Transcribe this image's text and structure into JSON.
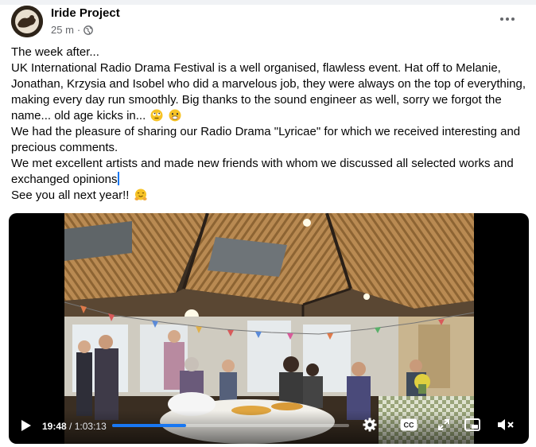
{
  "post": {
    "author": "Iride Project",
    "time": "25 m",
    "separator": "·",
    "lines": [
      "The week after...",
      "UK International Radio Drama Festival is a well organised, flawless event.  Hat off to Melanie,",
      "Jonathan, Krzysia and Isobel who did a marvelous job, they were always on the top of everything,",
      "making every day run smoothly. Big thanks to the sound engineer as well, sorry we forgot the",
      "name... old age kicks in...",
      "We had the pleasure of sharing our Radio Drama \"Lyricae\" for which we received interesting and",
      "precious comments.",
      "We met excellent artists and made new friends with whom we discussed all selected works and",
      "exchanged opinions",
      "See you all next year!!"
    ]
  },
  "video": {
    "current_time": "19:48",
    "duration": "/ 1:03:13",
    "progress": 0.313,
    "accent": "#1877f2"
  },
  "icons": {
    "more": "more-horizontal-icon",
    "privacy": "globe-icon",
    "play": "play-icon",
    "settings": "gear-icon",
    "captions": "closed-captions-icon",
    "fullscreen": "expand-icon",
    "pip": "picture-in-picture-icon",
    "mute": "volume-muted-icon"
  }
}
